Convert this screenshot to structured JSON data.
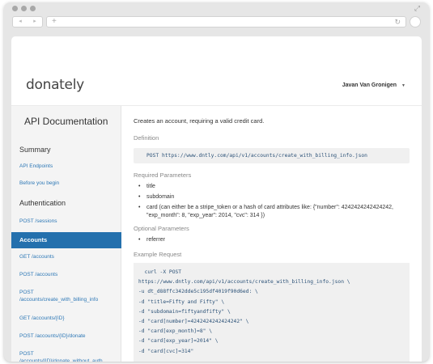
{
  "app": {
    "logo": "donately",
    "user_name": "Javan Van Gronigen"
  },
  "browser": {
    "back_icon": "◂",
    "forward_icon": "▸",
    "new_tab_icon": "+",
    "reload_icon": "↻",
    "expand_icon": "⤢"
  },
  "sidebar": {
    "title": "API Documentation",
    "summary_heading": "Summary",
    "summary_items": [
      "API Endpoints",
      "Before you begin"
    ],
    "auth_heading": "Authentication",
    "auth_items": [
      "POST /sessions"
    ],
    "accounts_heading": "Accounts",
    "accounts_items": [
      "GET /accounts",
      "POST /accounts",
      "POST\n/accounts/create_with_billing_info",
      "GET /accounts/{ID}",
      "POST /accounts/{ID}/donate",
      "POST\n/accounts/{ID}/donate_without_auth"
    ]
  },
  "main": {
    "intro": "Creates an account, requiring a valid credit card.",
    "definition_label": "Definition",
    "definition": "POST https://www.dntly.com/api/v1/accounts/create_with_billing_info.json",
    "required_label": "Required Parameters",
    "required_params": [
      "title",
      "subdomain",
      "card (can either be a stripe_token or a hash of card attributes like: {\"number\": 4242424242424242, \"exp_month\": 8, \"exp_year\": 2014, \"cvc\": 314 })"
    ],
    "optional_label": "Optional Parameters",
    "optional_params": [
      "referrer"
    ],
    "example_label": "Example Request",
    "example_code": "  curl -X POST\nhttps://www.dntly.com/api/v1/accounts/create_with_billing_info.json \\\n-u dt_d88ffc342dde5c195df4019f90d6ed: \\\n-d \"title=Fifty and Fifty\" \\\n-d \"subdomain=fiftyandfifty\" \\\n-d \"card[number]=4242424242424242\" \\\n-d \"card[exp_month]=8\" \\\n-d \"card[exp_year]=2014\" \\\n-d \"card[cvc]=314\""
  },
  "colors": {
    "accent": "#2470ad",
    "link": "#2e78b6",
    "code_text": "#2b5177"
  }
}
